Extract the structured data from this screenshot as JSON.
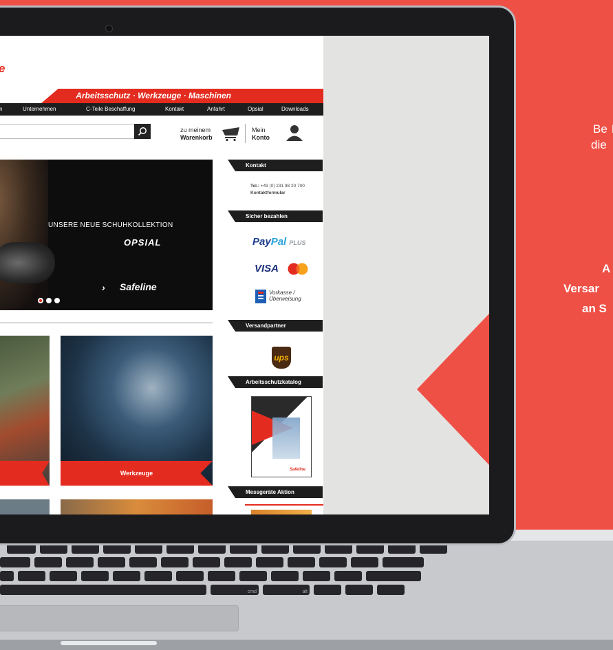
{
  "promo": {
    "line1": "Be",
    "line2": "die",
    "line3": "A",
    "line4": "Versar",
    "line5": "an S"
  },
  "site": {
    "logo": "e",
    "tagline": "Arbeitsschutz · Werkzeuge · Maschinen",
    "nav": [
      "n",
      "Unternehmen",
      "C-Teile Beschaffung",
      "Kontakt",
      "Anfahrt",
      "Opsial",
      "Downloads"
    ],
    "cart": {
      "line1": "zu meinem",
      "line2": "Warenkorb"
    },
    "account": {
      "line1": "Mein",
      "line2": "Konto"
    },
    "banner": {
      "headline": "UNSERE NEUE SCHUHKOLLEKTION",
      "brand": "OPSIAL",
      "logo": "Safeline",
      "slide_count": 3,
      "active_slide": 1
    },
    "tiles": [
      {
        "label": ""
      },
      {
        "label": "Werkzeuge"
      }
    ],
    "sidebar": {
      "kontakt": {
        "title": "Kontakt",
        "tel_label": "Tel.:",
        "tel": "+49 (0) 231 98 20 700",
        "form": "Kontaktformular"
      },
      "bezahlen": {
        "title": "Sicher bezahlen",
        "paypal_a": "Pay",
        "paypal_b": "Pal",
        "paypal_plus": "PLUS",
        "visa": "VISA",
        "vorkasse1": "Vorkasse /",
        "vorkasse2": "Überweisung"
      },
      "versand": {
        "title": "Versandpartner",
        "carrier": "ups"
      },
      "katalog": {
        "title": "Arbeitsschutzkatalog",
        "cover_brand": "Safeline"
      },
      "messgeraete": {
        "title": "Messgeräte Aktion"
      }
    }
  },
  "keyboard": {
    "labels": [
      "cmd",
      "alt"
    ]
  },
  "colors": {
    "brand_red": "#e42b1f",
    "background_red": "#ef5046",
    "nav_dark": "#1e1e1e"
  }
}
